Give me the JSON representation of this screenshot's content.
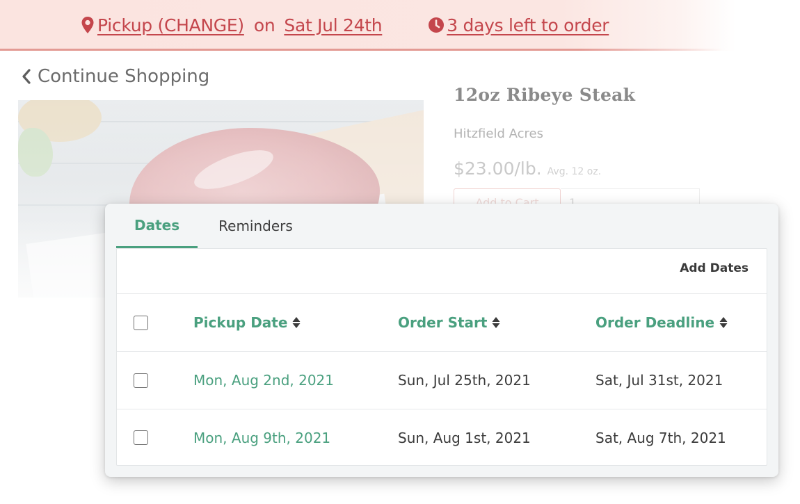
{
  "banner": {
    "pickup_link": "Pickup (CHANGE)",
    "on_word": "on",
    "date_link": "Sat Jul 24th",
    "days_left_link": "3 days left to order",
    "pin_icon": "location-pin-icon",
    "clock_icon": "clock-icon",
    "color": "#c4464c"
  },
  "page": {
    "continue_label": "Continue Shopping",
    "product_title": "12oz Ribeye Steak",
    "farm_name": "Hitzfield Acres",
    "price": "$23.00/lb.",
    "avg_weight": "Avg. 12 oz.",
    "add_to_cart": "Add to Cart",
    "quantity": "1"
  },
  "modal": {
    "tabs": [
      {
        "label": "Dates",
        "active": true
      },
      {
        "label": "Reminders",
        "active": false
      }
    ],
    "add_dates_label": "Add Dates",
    "columns": {
      "pickup": "Pickup Date",
      "order_start": "Order Start",
      "order_deadline": "Order Deadline"
    },
    "rows": [
      {
        "pickup": "Mon, Aug 2nd, 2021",
        "order_start": "Sun, Jul 25th, 2021",
        "order_deadline": "Sat, Jul 31st, 2021",
        "checked": false
      },
      {
        "pickup": "Mon, Aug 9th, 2021",
        "order_start": "Sun, Aug 1st, 2021",
        "order_deadline": "Sat, Aug 7th, 2021",
        "checked": false
      }
    ],
    "accent_color": "#4aa07f"
  }
}
